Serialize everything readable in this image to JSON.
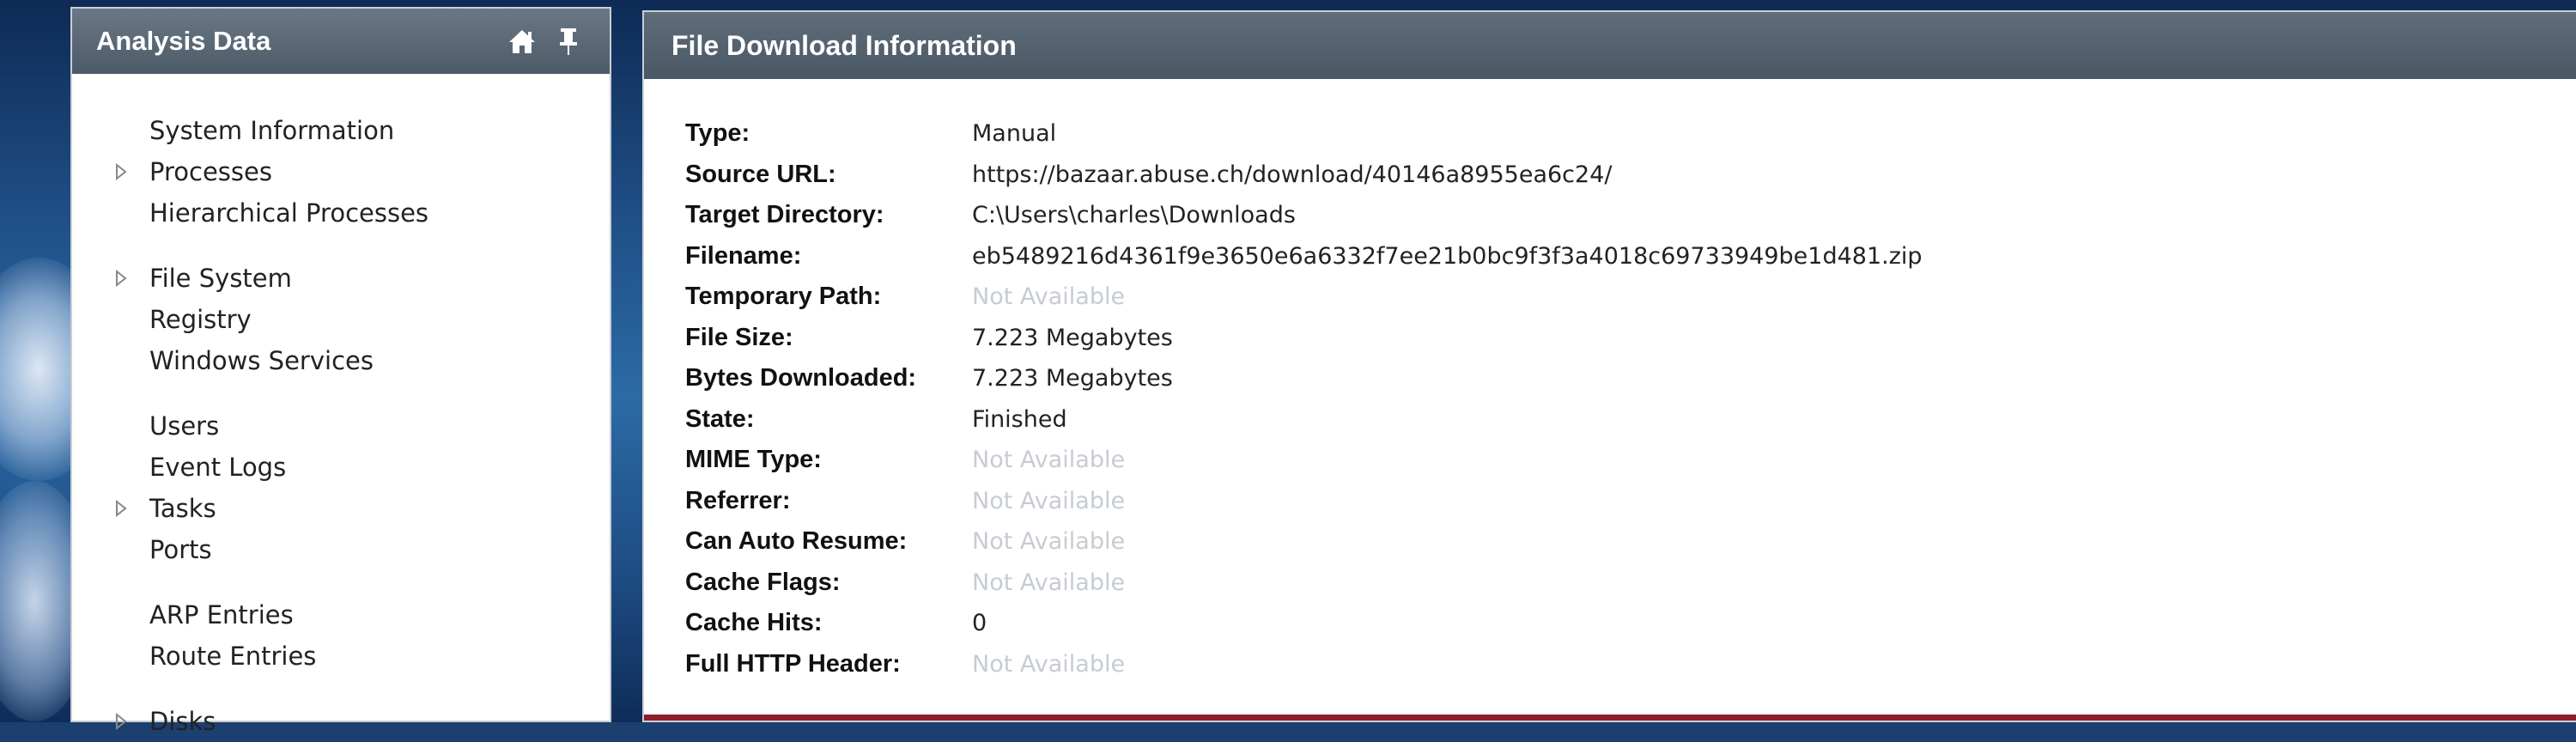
{
  "left_panel": {
    "title": "Analysis Data",
    "groups": [
      [
        {
          "label": "System Information",
          "expandable": false
        },
        {
          "label": "Processes",
          "expandable": true
        },
        {
          "label": "Hierarchical Processes",
          "expandable": false
        }
      ],
      [
        {
          "label": "File System",
          "expandable": true
        },
        {
          "label": "Registry",
          "expandable": false
        },
        {
          "label": "Windows Services",
          "expandable": false
        }
      ],
      [
        {
          "label": "Users",
          "expandable": false
        },
        {
          "label": "Event Logs",
          "expandable": false
        },
        {
          "label": "Tasks",
          "expandable": true
        },
        {
          "label": "Ports",
          "expandable": false
        }
      ],
      [
        {
          "label": "ARP Entries",
          "expandable": false
        },
        {
          "label": "Route Entries",
          "expandable": false
        }
      ],
      [
        {
          "label": "Disks",
          "expandable": true
        }
      ]
    ],
    "icons": [
      "home-icon",
      "pin-icon"
    ]
  },
  "right_panel": {
    "title": "File Download Information",
    "rows": [
      {
        "label": "Type:",
        "value": "Manual",
        "available": true
      },
      {
        "label": "Source URL:",
        "value": "https://bazaar.abuse.ch/download/40146a8955ea6c24/",
        "available": true
      },
      {
        "label": "Target Directory:",
        "value": "C:\\Users\\charles\\Downloads",
        "available": true
      },
      {
        "label": "Filename:",
        "value": "eb5489216d4361f9e3650e6a6332f7ee21b0bc9f3f3a4018c69733949be1d481.zip",
        "available": true
      },
      {
        "label": "Temporary Path:",
        "value": "Not Available",
        "available": false
      },
      {
        "label": "File Size:",
        "value": "7.223 Megabytes",
        "available": true
      },
      {
        "label": "Bytes Downloaded:",
        "value": "7.223 Megabytes",
        "available": true
      },
      {
        "label": "State:",
        "value": "Finished",
        "available": true
      },
      {
        "label": "MIME Type:",
        "value": "Not Available",
        "available": false
      },
      {
        "label": "Referrer:",
        "value": "Not Available",
        "available": false
      },
      {
        "label": "Can Auto Resume:",
        "value": "Not Available",
        "available": false
      },
      {
        "label": "Cache Flags:",
        "value": "Not Available",
        "available": false
      },
      {
        "label": "Cache Hits:",
        "value": "0",
        "available": true
      },
      {
        "label": "Full HTTP Header:",
        "value": "Not Available",
        "available": false
      }
    ]
  },
  "colors": {
    "header_bg": "#4d5a68",
    "accent_bottom": "#8d1f2d",
    "not_available_text": "#c7ccd2"
  }
}
